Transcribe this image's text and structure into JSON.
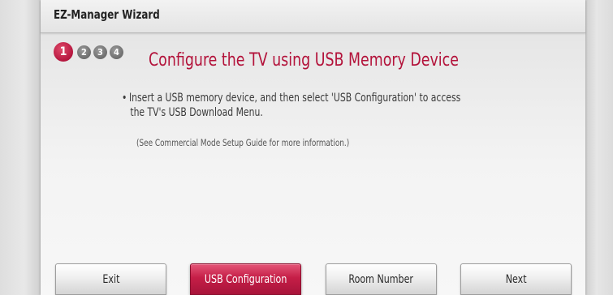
{
  "window": {
    "title": "EZ-Manager Wizard"
  },
  "steps": {
    "items": [
      "1",
      "2",
      "3",
      "4"
    ],
    "current": "1"
  },
  "main": {
    "heading": "Configure the TV using USB Memory Device",
    "bullet": "•",
    "instruction_line1": "Insert a USB memory device, and then select 'USB Configuration' to access",
    "instruction_line2": "the TV's USB Download Menu.",
    "note": "(See Commercial Mode Setup Guide for more information.)"
  },
  "buttons": {
    "exit": "Exit",
    "usb_configuration": "USB Configuration",
    "room_number": "Room Number",
    "next": "Next",
    "selected": "USB Configuration"
  },
  "colors": {
    "accent": "#b3123a",
    "step_inactive": "#6e6e6e"
  }
}
